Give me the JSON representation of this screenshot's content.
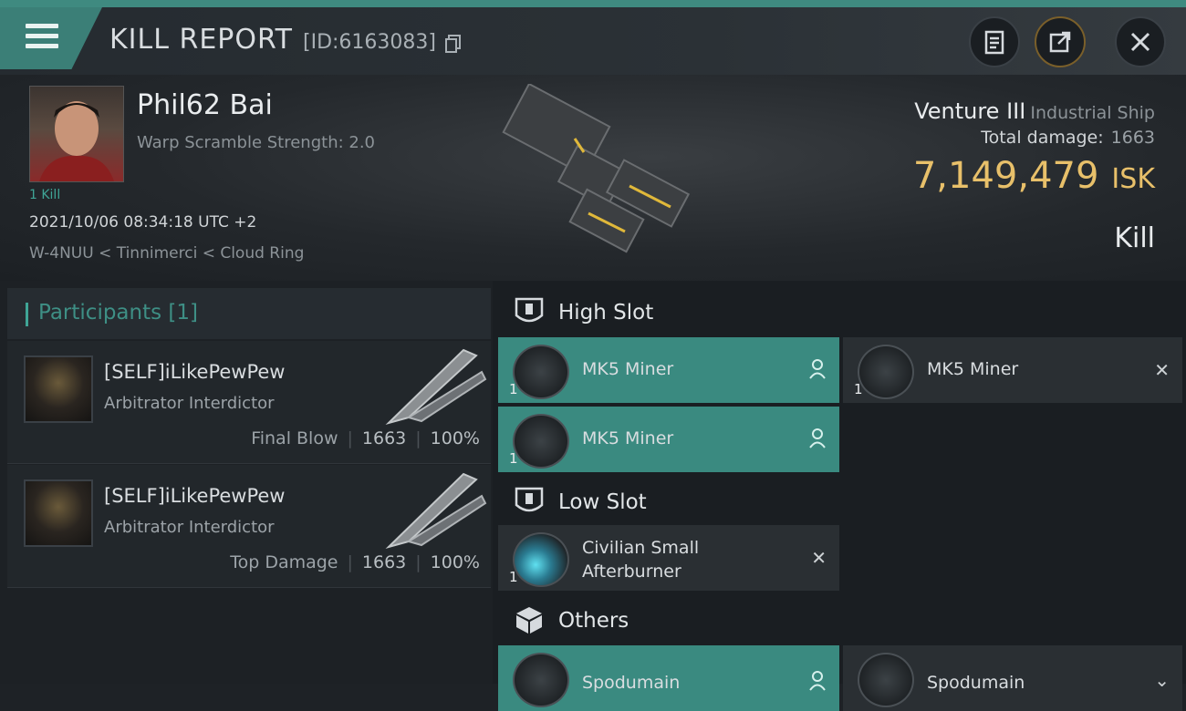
{
  "header": {
    "title": "KILL REPORT",
    "report_id": "[ID:6163083]",
    "icons": {
      "menu": "menu-icon",
      "copy": "copy-icon",
      "clipboard": "clipboard-icon",
      "share": "share-icon",
      "close": "close-icon"
    }
  },
  "victim": {
    "pilot_name": "Phil62 Bai",
    "warp_scramble": "Warp Scramble Strength: 2.0",
    "kills": "1 Kill",
    "datetime": "2021/10/06 08:34:18 UTC +2",
    "location": "W-4NUU < Tinnimerci < Cloud Ring",
    "ship_name": "Venture III",
    "ship_class": "Industrial Ship",
    "total_damage_label": "Total damage:",
    "total_damage": "1663",
    "isk_value": "7,149,479",
    "isk_unit": "ISK",
    "result": "Kill"
  },
  "participants": {
    "title": "Participants [1]",
    "items": [
      {
        "name": "[SELF]iLikePewPew",
        "ship": "Arbitrator Interdictor",
        "tag": "Final Blow",
        "damage": "1663",
        "percent": "100%"
      },
      {
        "name": "[SELF]iLikePewPew",
        "ship": "Arbitrator Interdictor",
        "tag": "Top Damage",
        "damage": "1663",
        "percent": "100%"
      }
    ]
  },
  "fitting": {
    "high_slot": {
      "title": "High Slot",
      "items": [
        {
          "name": "MK5 Miner",
          "qty": "1"
        },
        {
          "name": "MK5 Miner",
          "qty": "1"
        },
        {
          "name": "MK5 Miner",
          "qty": "1"
        }
      ]
    },
    "low_slot": {
      "title": "Low Slot",
      "items": [
        {
          "name_line1": "Civilian Small",
          "name_line2": "Afterburner",
          "qty": "1"
        }
      ]
    },
    "others": {
      "title": "Others",
      "items": [
        {
          "name": "Spodumain"
        },
        {
          "name": "Spodumain"
        }
      ]
    }
  },
  "colors": {
    "accent": "#3b7f77",
    "isk": "#e8c06a",
    "teal_text": "#3fa596"
  }
}
